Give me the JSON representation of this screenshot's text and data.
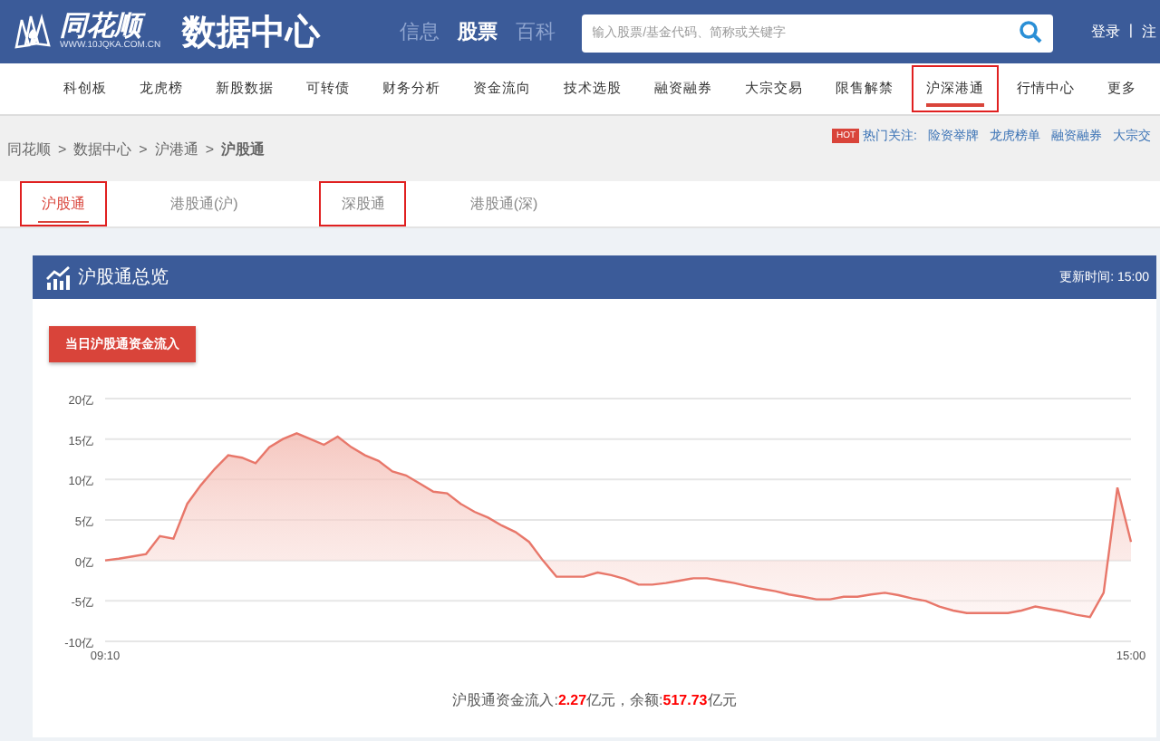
{
  "header": {
    "logo_name": "同花顺",
    "logo_url": "WWW.10JQKA.COM.CN",
    "site_title": "数据中心",
    "channels": [
      {
        "label": "信息",
        "selected": false
      },
      {
        "label": "股票",
        "selected": true
      },
      {
        "label": "百科",
        "selected": false
      }
    ],
    "search": {
      "placeholder": "输入股票/基金代码、简称或关键字"
    },
    "account": [
      {
        "label": "登录"
      },
      {
        "label": "|"
      },
      {
        "label": "注"
      }
    ]
  },
  "nav": [
    {
      "label": "科创板",
      "selected": false,
      "highlighted": false
    },
    {
      "label": "龙虎榜",
      "selected": false,
      "highlighted": false
    },
    {
      "label": "新股数据",
      "selected": false,
      "highlighted": false
    },
    {
      "label": "可转债",
      "selected": false,
      "highlighted": false
    },
    {
      "label": "财务分析",
      "selected": false,
      "highlighted": false
    },
    {
      "label": "资金流向",
      "selected": false,
      "highlighted": false
    },
    {
      "label": "技术选股",
      "selected": false,
      "highlighted": false
    },
    {
      "label": "融资融券",
      "selected": false,
      "highlighted": false
    },
    {
      "label": "大宗交易",
      "selected": false,
      "highlighted": false
    },
    {
      "label": "限售解禁",
      "selected": false,
      "highlighted": false
    },
    {
      "label": "沪深港通",
      "selected": true,
      "highlighted": true
    },
    {
      "label": "行情中心",
      "selected": false,
      "highlighted": false
    },
    {
      "label": "更多",
      "selected": false,
      "highlighted": false
    }
  ],
  "breadcrumb": [
    {
      "label": "同花顺"
    },
    {
      "label": ">"
    },
    {
      "label": "数据中心"
    },
    {
      "label": ">"
    },
    {
      "label": "沪港通"
    },
    {
      "label": ">"
    },
    {
      "label": "沪股通"
    }
  ],
  "hot": {
    "badge": "HOT",
    "label": "热门关注:",
    "links": [
      "险资举牌",
      "龙虎榜单",
      "融资融券",
      "大宗交"
    ]
  },
  "tabs": [
    {
      "label": "沪股通",
      "selected": true,
      "highlighted": true
    },
    {
      "label": "港股通(沪)",
      "selected": false,
      "highlighted": false
    },
    {
      "label": "深股通",
      "selected": false,
      "highlighted": true
    },
    {
      "label": "港股通(深)",
      "selected": false,
      "highlighted": false
    }
  ],
  "panel": {
    "title": "沪股通总览",
    "update_label": "更新时间:",
    "update_time": "15:00",
    "flow_button": "当日沪股通资金流入",
    "chart_data": {
      "type": "area",
      "yticks": [
        {
          "value": 20,
          "label": "20亿"
        },
        {
          "value": 15,
          "label": "15亿"
        },
        {
          "value": 10,
          "label": "10亿"
        },
        {
          "value": 5,
          "label": "5亿"
        },
        {
          "value": 0,
          "label": "0亿"
        },
        {
          "value": -5,
          "label": "-5亿"
        },
        {
          "value": -10,
          "label": "-10亿"
        }
      ],
      "ylim": [
        -10,
        20
      ],
      "grid": true,
      "categories": [
        "09:10",
        null,
        null,
        null,
        null,
        null,
        null,
        null,
        null,
        null,
        null,
        null,
        null,
        null,
        null,
        null,
        null,
        null,
        null,
        null,
        null,
        null,
        null,
        null,
        null,
        null,
        null,
        null,
        null,
        null,
        null,
        null,
        null,
        null,
        null,
        null,
        null,
        null,
        null,
        null,
        null,
        null,
        null,
        null,
        null,
        null,
        null,
        null,
        null,
        null,
        null,
        null,
        null,
        null,
        null,
        null,
        null,
        null,
        null,
        null,
        null,
        null,
        null,
        null,
        null,
        null,
        null,
        null,
        null,
        null,
        null,
        null,
        null,
        null,
        null,
        "15:00"
      ],
      "series": [
        {
          "color": "#e8776a",
          "values": [
            0,
            0.2,
            0.5,
            0.8,
            3,
            2.7,
            7,
            9.3,
            11.3,
            13,
            12.7,
            12,
            14,
            15,
            15.7,
            15,
            14.3,
            15.3,
            14,
            13,
            12.3,
            11,
            10.5,
            9.5,
            8.5,
            8.3,
            7,
            6,
            5.3,
            4.3,
            3.5,
            2.3,
            0,
            -2,
            -2,
            -2,
            -1.5,
            -1.8,
            -2.3,
            -3,
            -3,
            -2.8,
            -2.5,
            -2.2,
            -2.2,
            -2.5,
            -2.8,
            -3.2,
            -3.5,
            -3.8,
            -4.2,
            -4.5,
            -4.8,
            -4.8,
            -4.5,
            -4.5,
            -4.2,
            -4,
            -4.3,
            -4.7,
            -5,
            -5.7,
            -6.2,
            -6.5,
            -6.5,
            -6.5,
            -6.5,
            -6.2,
            -5.7,
            -6,
            -6.3,
            -6.7,
            -7,
            -4,
            9,
            2.3
          ]
        }
      ]
    },
    "summary": "沪股通资金流入:**2.27**亿元，余额:**517.73**亿元"
  }
}
